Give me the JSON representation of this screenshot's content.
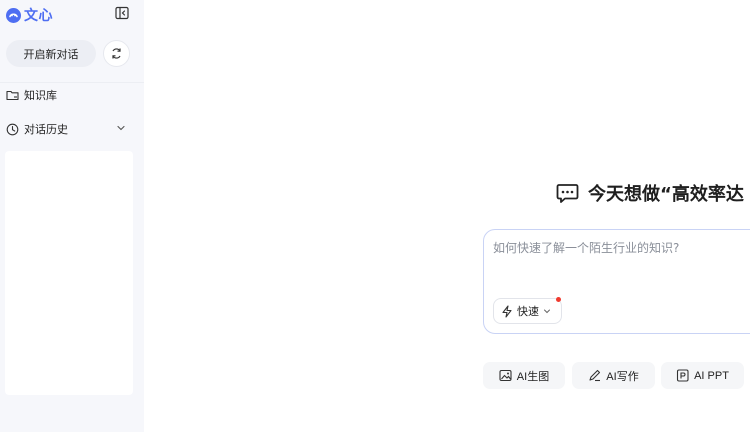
{
  "brand": {
    "name": "文心",
    "color": "#4e6ef2"
  },
  "sidebar": {
    "new_chat_label": "开启新对话",
    "items": [
      {
        "label": "知识库",
        "icon": "folder-icon"
      },
      {
        "label": "对话历史",
        "icon": "clock-icon"
      }
    ]
  },
  "main": {
    "headline": "今天想做“高效率达",
    "input": {
      "placeholder": "如何快速了解一个陌生行业的知识?",
      "value": ""
    },
    "mode": {
      "label": "快速",
      "icon": "lightning-icon"
    },
    "tools": [
      {
        "label": "AI生图",
        "icon": "image-icon"
      },
      {
        "label": "AI写作",
        "icon": "pen-icon"
      },
      {
        "label": "AI PPT",
        "icon": "ppt-icon"
      }
    ]
  }
}
